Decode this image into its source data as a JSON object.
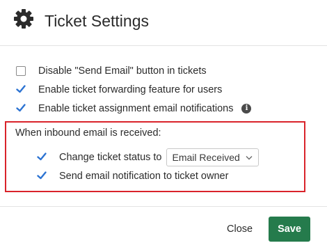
{
  "header": {
    "title": "Ticket Settings",
    "icon": "gear-icon"
  },
  "options": [
    {
      "label": "Disable \"Send Email\" button in tickets",
      "checked": false
    },
    {
      "label": "Enable ticket forwarding feature for users",
      "checked": true
    },
    {
      "label": "Enable ticket assignment email notifications",
      "checked": true,
      "info_icon": "info-icon"
    }
  ],
  "inbound": {
    "heading": "When inbound email is received:",
    "status": {
      "label": "Change ticket status to",
      "checked": true,
      "selected": "Email Received"
    },
    "notify": {
      "label": "Send email notification to ticket owner",
      "checked": true
    }
  },
  "footer": {
    "close_label": "Close",
    "save_label": "Save"
  },
  "colors": {
    "accent": "#2c73d2",
    "save": "#257b4c",
    "highlight": "#d9232a"
  }
}
